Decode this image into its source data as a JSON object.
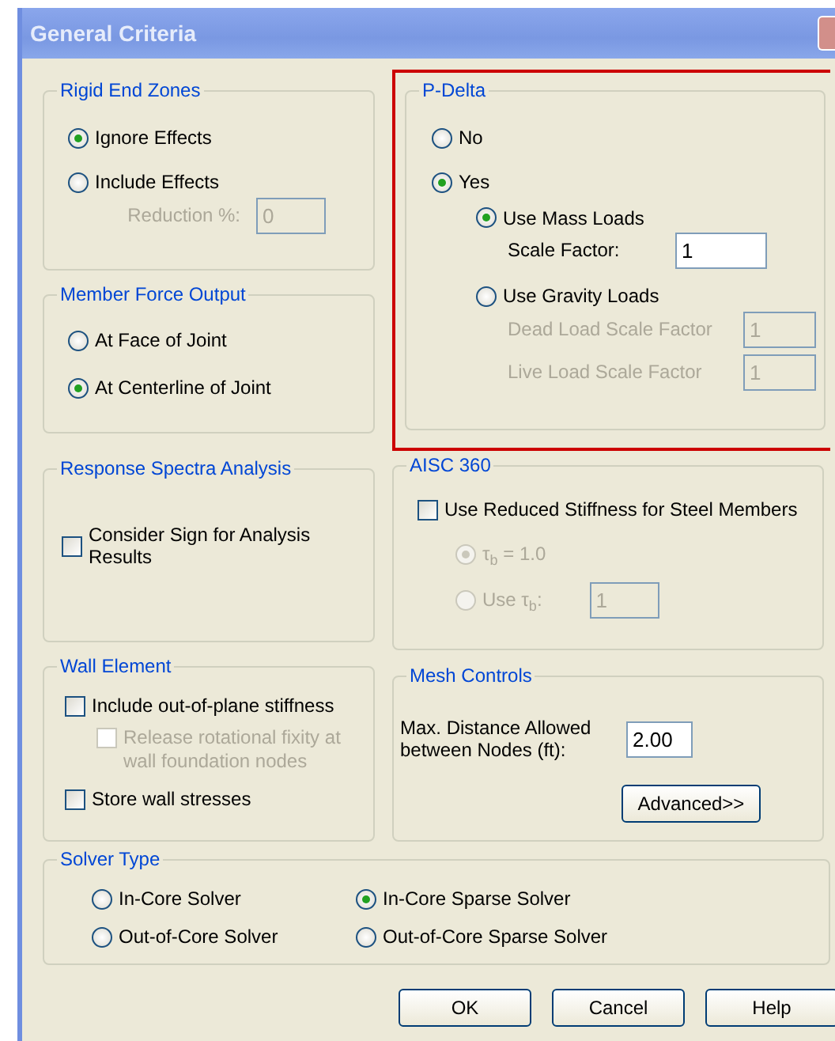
{
  "window": {
    "title": "General Criteria"
  },
  "rigid_end_zones": {
    "title": "Rigid End Zones",
    "options": [
      {
        "label": "Ignore Effects",
        "selected": true
      },
      {
        "label": "Include Effects",
        "selected": false
      }
    ],
    "reduction": {
      "label": "Reduction %:",
      "value": "0",
      "disabled": true
    }
  },
  "member_force_output": {
    "title": "Member Force Output",
    "options": [
      {
        "label": "At Face of Joint",
        "selected": false
      },
      {
        "label": "At Centerline of Joint",
        "selected": true
      }
    ]
  },
  "p_delta": {
    "title": "P-Delta",
    "highlighted": true,
    "options": [
      {
        "label": "No",
        "selected": false
      },
      {
        "label": "Yes",
        "selected": true
      }
    ],
    "load_options": [
      {
        "label": "Use Mass Loads",
        "selected": true,
        "fields": [
          {
            "label": "Scale Factor:",
            "value": "1",
            "disabled": false
          }
        ]
      },
      {
        "label": "Use Gravity Loads",
        "selected": false,
        "fields": [
          {
            "label": "Dead Load Scale Factor",
            "value": "1",
            "disabled": true
          },
          {
            "label": "Live Load Scale Factor",
            "value": "1",
            "disabled": true
          }
        ]
      }
    ]
  },
  "response_spectra": {
    "title": "Response Spectra Analysis",
    "checkboxes": [
      {
        "label": "Consider Sign for Analysis Results",
        "checked": false,
        "disabled": false
      }
    ]
  },
  "aisc_360": {
    "title": "AISC 360",
    "checkbox": {
      "label": "Use Reduced Stiffness for Steel Members",
      "checked": false
    },
    "options": [
      {
        "label": "τ$_{b}$ = 1.0",
        "selected": true,
        "disabled": true
      },
      {
        "label": "Use  τ$_{b}$:",
        "selected": false,
        "disabled": true,
        "value": "1"
      }
    ]
  },
  "wall_element": {
    "title": "Wall Element",
    "checkboxes": [
      {
        "label": "Include out-of-plane stiffness",
        "checked": false,
        "disabled": false,
        "children": [
          {
            "label": "Release rotational fixity at wall foundation nodes",
            "checked": false,
            "disabled": true
          }
        ]
      },
      {
        "label": "Store wall stresses",
        "checked": false,
        "disabled": false
      }
    ]
  },
  "mesh_controls": {
    "title": "Mesh Controls",
    "field": {
      "label": "Max. Distance Allowed between Nodes (ft):",
      "value": "2.00"
    },
    "button": "Advanced>>"
  },
  "solver_type": {
    "title": "Solver Type",
    "options": [
      {
        "label": "In-Core Solver",
        "selected": false
      },
      {
        "label": "In-Core Sparse Solver",
        "selected": true
      },
      {
        "label": "Out-of-Core Solver",
        "selected": false
      },
      {
        "label": "Out-of-Core Sparse Solver",
        "selected": false
      }
    ]
  },
  "buttons": [
    "OK",
    "Cancel",
    "Help"
  ]
}
